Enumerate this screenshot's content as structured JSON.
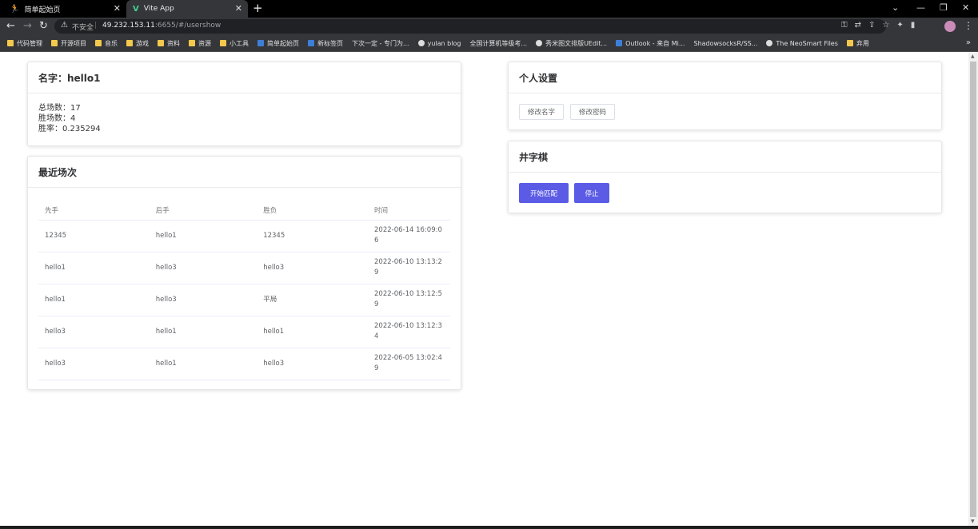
{
  "browser": {
    "tabs": [
      {
        "title": "简单起始页"
      },
      {
        "title": "Vite App"
      }
    ],
    "address": {
      "security_label": "不安全",
      "host": "49.232.153.11",
      "path": ":6655/#/usershow"
    },
    "bookmarks": [
      {
        "label": "代码管理",
        "icon": "folder"
      },
      {
        "label": "开源项目",
        "icon": "folder"
      },
      {
        "label": "音乐",
        "icon": "folder"
      },
      {
        "label": "游戏",
        "icon": "folder"
      },
      {
        "label": "资料",
        "icon": "folder"
      },
      {
        "label": "资源",
        "icon": "folder"
      },
      {
        "label": "小工具",
        "icon": "folder"
      },
      {
        "label": "简单起始页",
        "icon": "blue"
      },
      {
        "label": "新标签页",
        "icon": "blue"
      },
      {
        "label": "下次一定 - 专门为...",
        "icon": "page"
      },
      {
        "label": "yulan blog",
        "icon": "globe"
      },
      {
        "label": "全国计算机等级考...",
        "icon": "page"
      },
      {
        "label": "秀米图文排版UEdit...",
        "icon": "globe"
      },
      {
        "label": "Outlook - 来自 Mi...",
        "icon": "blue"
      },
      {
        "label": "ShadowsocksR/SS...",
        "icon": "page"
      },
      {
        "label": "The NeoSmart Files",
        "icon": "globe"
      },
      {
        "label": "弃用",
        "icon": "folder"
      }
    ]
  },
  "profile": {
    "title": "名字：hello1",
    "total_games": "总场数：17",
    "wins": "胜场数：4",
    "win_rate": "胜率：0.235294"
  },
  "recent": {
    "title": "最近场次",
    "columns": [
      "先手",
      "后手",
      "胜负",
      "时间"
    ],
    "rows": [
      [
        "12345",
        "hello1",
        "12345",
        "2022-06-14 16:09:06"
      ],
      [
        "hello1",
        "hello3",
        "hello3",
        "2022-06-10 13:13:29"
      ],
      [
        "hello1",
        "hello3",
        "平局",
        "2022-06-10 13:12:59"
      ],
      [
        "hello3",
        "hello1",
        "hello1",
        "2022-06-10 13:12:34"
      ],
      [
        "hello3",
        "hello1",
        "hello3",
        "2022-06-05 13:02:49"
      ]
    ]
  },
  "settings": {
    "title": "个人设置",
    "rename_label": "修改名字",
    "change_password_label": "修改密码"
  },
  "game": {
    "title": "井字棋",
    "start_label": "开始匹配",
    "stop_label": "停止"
  },
  "colors": {
    "primary": "#5b5be6",
    "chrome_dark": "#35363a"
  }
}
